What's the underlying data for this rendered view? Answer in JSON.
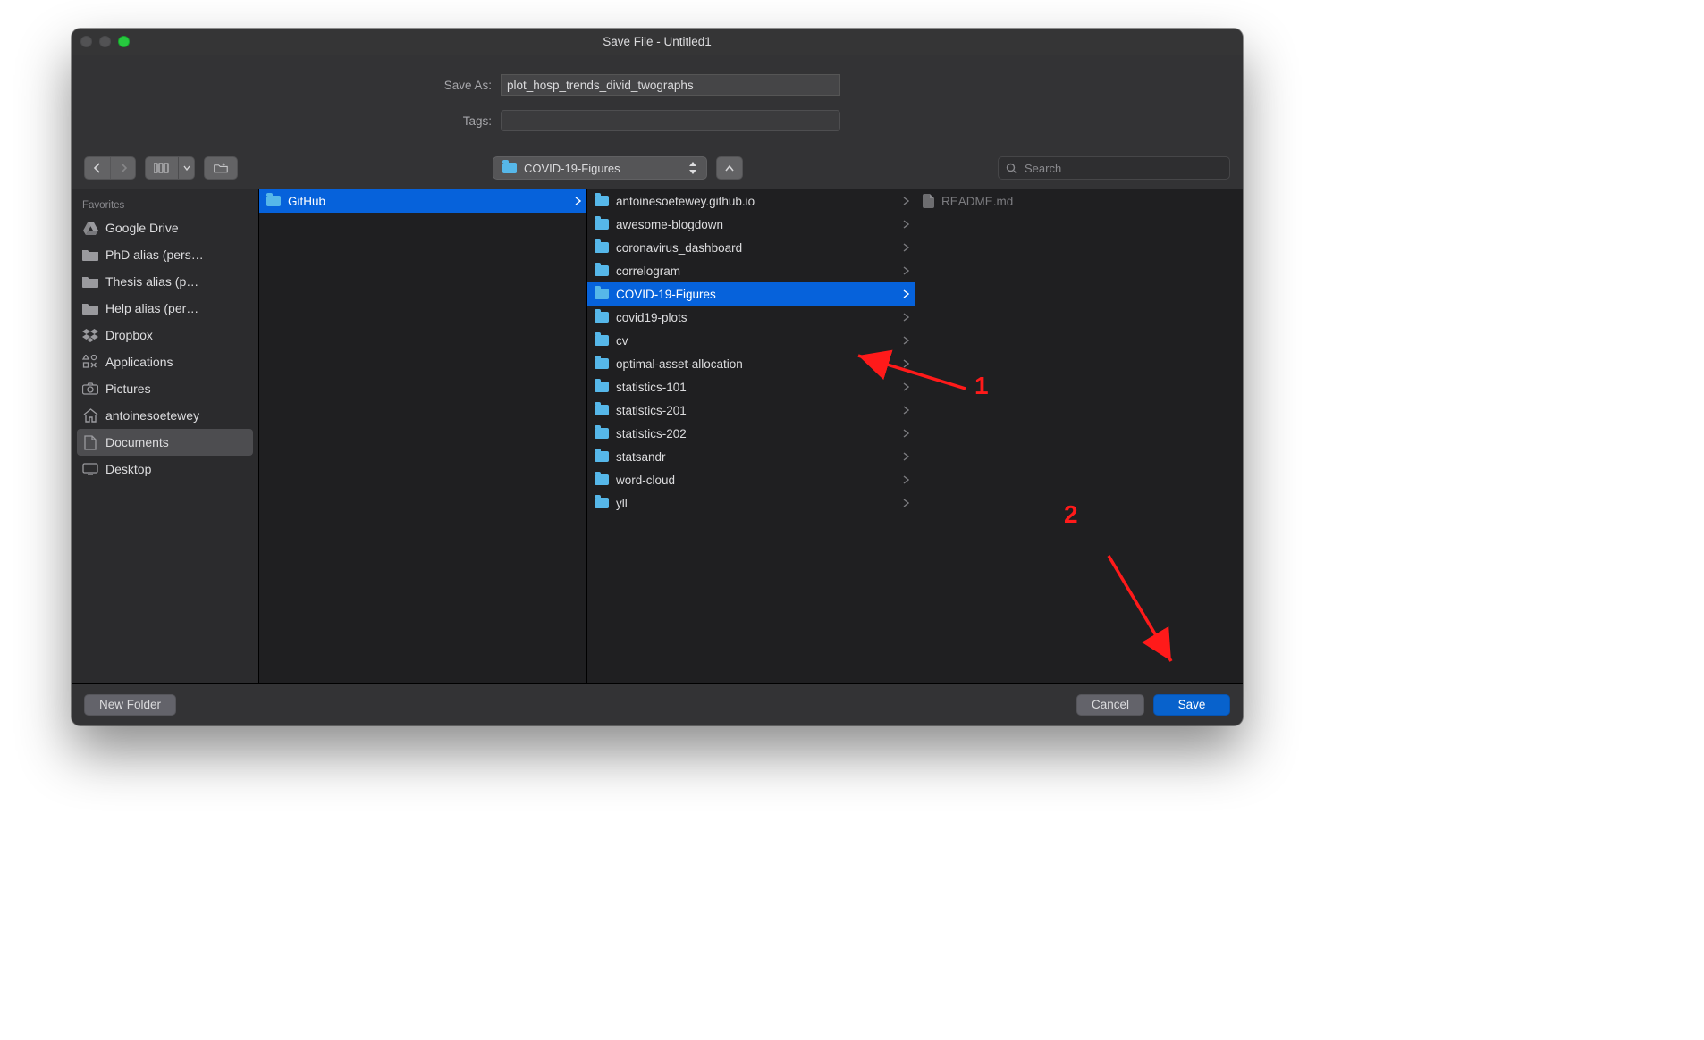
{
  "window": {
    "title": "Save File - Untitled1"
  },
  "form": {
    "save_as_label": "Save As:",
    "save_as_value": "plot_hosp_trends_divid_twographs",
    "tags_label": "Tags:",
    "tags_value": ""
  },
  "toolbar": {
    "path_folder": "COVID-19-Figures",
    "search_placeholder": "Search"
  },
  "sidebar": {
    "header": "Favorites",
    "items": [
      {
        "icon": "gdrive-icon",
        "label": "Google Drive"
      },
      {
        "icon": "folder-grey-icon",
        "label": "PhD alias (pers…"
      },
      {
        "icon": "folder-grey-icon",
        "label": "Thesis alias (p…"
      },
      {
        "icon": "folder-grey-icon",
        "label": "Help alias (per…"
      },
      {
        "icon": "dropbox-icon",
        "label": "Dropbox"
      },
      {
        "icon": "apps-icon",
        "label": "Applications"
      },
      {
        "icon": "camera-icon",
        "label": "Pictures"
      },
      {
        "icon": "home-icon",
        "label": "antoinesoetewey"
      },
      {
        "icon": "documents-icon",
        "label": "Documents",
        "selected": true
      },
      {
        "icon": "desktop-icon",
        "label": "Desktop"
      }
    ]
  },
  "columns": {
    "c1": [
      {
        "label": "GitHub",
        "folder": true,
        "selected": true
      }
    ],
    "c2": [
      {
        "label": "antoinesoetewey.github.io",
        "folder": true
      },
      {
        "label": "awesome-blogdown",
        "folder": true
      },
      {
        "label": "coronavirus_dashboard",
        "folder": true
      },
      {
        "label": "correlogram",
        "folder": true
      },
      {
        "label": "COVID-19-Figures",
        "folder": true,
        "selected": true
      },
      {
        "label": "covid19-plots",
        "folder": true
      },
      {
        "label": "cv",
        "folder": true
      },
      {
        "label": "optimal-asset-allocation",
        "folder": true
      },
      {
        "label": "statistics-101",
        "folder": true
      },
      {
        "label": "statistics-201",
        "folder": true
      },
      {
        "label": "statistics-202",
        "folder": true
      },
      {
        "label": "statsandr",
        "folder": true
      },
      {
        "label": "word-cloud",
        "folder": true
      },
      {
        "label": "yll",
        "folder": true
      }
    ],
    "c3": [
      {
        "label": "README.md",
        "folder": false,
        "dim": true
      }
    ]
  },
  "buttons": {
    "new_folder": "New Folder",
    "cancel": "Cancel",
    "save": "Save"
  },
  "annotations": {
    "one": "1",
    "two": "2"
  }
}
